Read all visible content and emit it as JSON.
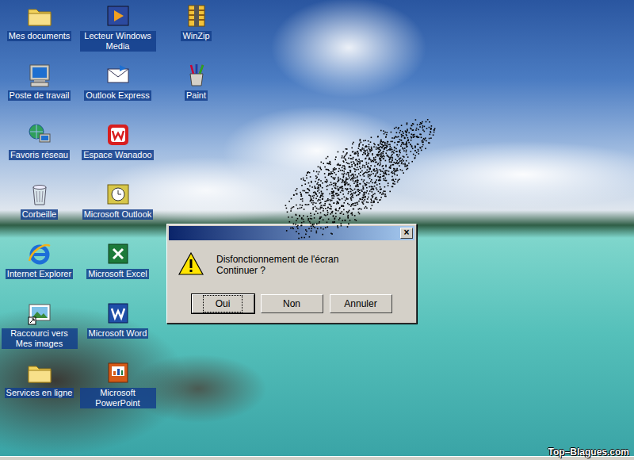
{
  "desktop": {
    "icon_columns": [
      {
        "icons": [
          {
            "label": "Mes documents"
          },
          {
            "label": "Poste de travail"
          },
          {
            "label": "Favoris réseau"
          },
          {
            "label": "Corbeille"
          },
          {
            "label": "Internet Explorer"
          },
          {
            "label": "Raccourci vers Mes images"
          },
          {
            "label": "Services en ligne"
          }
        ]
      },
      {
        "icons": [
          {
            "label": "Lecteur Windows Media"
          },
          {
            "label": "Outlook Express"
          },
          {
            "label": "Espace Wanadoo"
          },
          {
            "label": "Microsoft Outlook"
          },
          {
            "label": "Microsoft Excel"
          },
          {
            "label": "Microsoft Word"
          },
          {
            "label": "Microsoft PowerPoint"
          }
        ]
      },
      {
        "icons": [
          {
            "label": "WinZip"
          },
          {
            "label": "Paint"
          }
        ]
      }
    ]
  },
  "dialog": {
    "close": "×",
    "message": [
      "Disfonctionnement de l'écran",
      "Continuer ?"
    ],
    "buttons": [
      {
        "label": "Oui",
        "selected": true
      },
      {
        "label": "Non",
        "selected": false
      },
      {
        "label": "Annuler",
        "selected": false
      }
    ]
  },
  "watermark": "Top–Blagues.com"
}
